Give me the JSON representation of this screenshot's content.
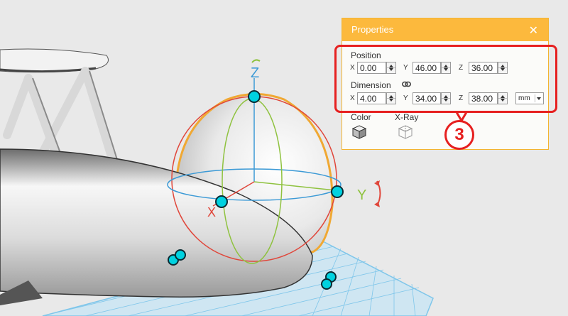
{
  "viewport": {
    "gizmo_labels": {
      "x": "X",
      "y": "Y",
      "z": "Z"
    }
  },
  "properties": {
    "title": "Properties",
    "close_glyph": "✕",
    "position": {
      "label": "Position",
      "x_label": "X",
      "x_value": "0.00",
      "y_label": "Y",
      "y_value": "46.00",
      "z_label": "Z",
      "z_value": "36.00"
    },
    "dimension": {
      "label": "Dimension",
      "link_icon": "chain-link-icon",
      "x_label": "X",
      "x_value": "4.00",
      "y_label": "Y",
      "y_value": "34.00",
      "z_label": "Z",
      "z_value": "38.00",
      "unit": "mm"
    },
    "color_label": "Color",
    "xray_label": "X-Ray"
  },
  "callout": {
    "number": "3",
    "color": "#e62020"
  },
  "colors": {
    "panel_header": "#fcb93d",
    "grid": "#7fc6ea",
    "gizmo_x": "#e0463a",
    "gizmo_y": "#8fc23f",
    "gizmo_z": "#3c9ad6",
    "handle": "#00d2e0"
  }
}
